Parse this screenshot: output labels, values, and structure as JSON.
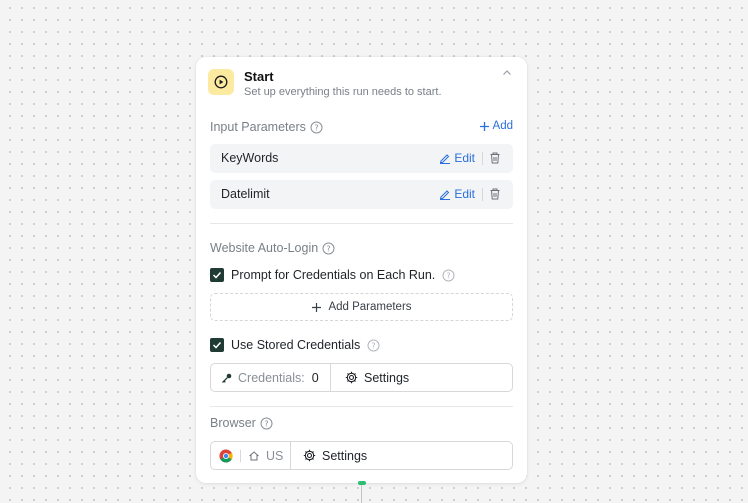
{
  "start": {
    "title": "Start",
    "subtitle": "Set up everything this run needs to start."
  },
  "input_parameters": {
    "label": "Input Parameters",
    "add_label": "Add",
    "edit_label": "Edit",
    "items": [
      {
        "name": "KeyWords"
      },
      {
        "name": "Datelimit"
      }
    ]
  },
  "auto_login": {
    "label": "Website Auto-Login",
    "prompt_label": "Prompt for Credentials on Each Run.",
    "prompt_checked": true,
    "add_params_label": "Add Parameters",
    "stored_label": "Use Stored Credentials",
    "stored_checked": true,
    "credentials_label": "Credentials:",
    "credentials_count": "0",
    "settings_label": "Settings"
  },
  "browser": {
    "label": "Browser",
    "region": "US",
    "settings_label": "Settings"
  },
  "colors": {
    "accent": "#2a6fdb",
    "start_icon_bg": "#fbeaa0",
    "checkbox": "#1f3b33",
    "connector": "#2dbd74"
  }
}
